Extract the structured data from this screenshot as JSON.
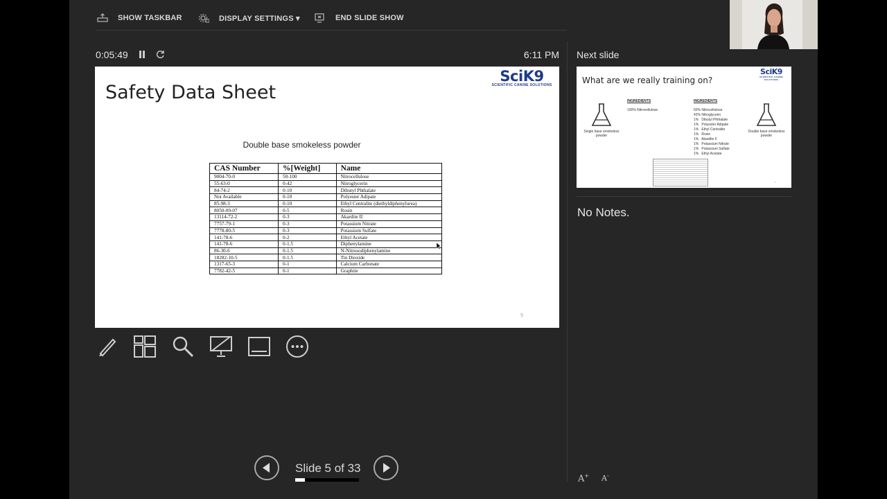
{
  "toolbar": {
    "show_taskbar": "SHOW TASKBAR",
    "display_settings": "DISPLAY SETTINGS ▾",
    "end_slide_show": "END SLIDE SHOW"
  },
  "status": {
    "elapsed": "0:05:49",
    "clock": "6:11 PM"
  },
  "current_slide": {
    "title": "Safety Data Sheet",
    "logo_text": "SciK9",
    "logo_subtext": "SCIENTIFIC CANINE SOLUTIONS",
    "subtitle": "Double base smokeless powder",
    "table": {
      "headers": [
        "CAS Number",
        "%[Weight]",
        "Name"
      ],
      "rows": [
        [
          "9004-70-0",
          "50-100",
          "Nitrocellulose"
        ],
        [
          "55-63-0",
          "0-42",
          "Nitroglycerin"
        ],
        [
          "84-74-2",
          "0-10",
          "Dibutyl Phthalate"
        ],
        [
          "Not Available",
          "0-10",
          "Polyester Adipate"
        ],
        [
          "85-98-3",
          "0-10",
          "Ethyl Centralite (diethyldiphenylurea)"
        ],
        [
          "8050-09-07",
          "0-5",
          "Rosin"
        ],
        [
          "13114-72-2",
          "0-3",
          "Akardite II"
        ],
        [
          "7757-79-1",
          "0-3",
          "Potassium Nitrate"
        ],
        [
          "7778-80-5",
          "0-3",
          "Potassium Sulfate"
        ],
        [
          "141-78-6",
          "0-2",
          "Ethyl Acetate"
        ],
        [
          "141-78-6",
          "0-1.5",
          "Diphenylamine"
        ],
        [
          "86-30-6",
          "0-1.5",
          "N-Nitrosodiphenylamine"
        ],
        [
          "18282-10-5",
          "0-1.5",
          "Tin Dioxide"
        ],
        [
          "1317-65-3",
          "0-1",
          "Calcium Carbonate"
        ],
        [
          "7782-42-5",
          "0-1",
          "Graphite"
        ]
      ]
    },
    "page_number": "5"
  },
  "tools": [
    "pen-icon",
    "slides-grid-icon",
    "zoom-icon",
    "pointer-icon",
    "subtitles-icon",
    "more-icon"
  ],
  "navigation": {
    "slide_counter": "Slide 5 of 33",
    "progress": 0.1515
  },
  "next_slide": {
    "label": "Next slide",
    "title": "What are we really training on?",
    "logo_text": "SciK9",
    "left_caption": "Single base smokeless powder",
    "right_caption": "Double base smokeless powder",
    "ingredients_heading": "INGREDIENTS",
    "left_ingredients": [
      "100% Nitrocellulose"
    ],
    "right_ingredients": [
      "50% Nitrocellulose",
      "42% Nitroglycerin",
      "1%   Dibutyl Phthalate",
      "1%   Polyester Adipate",
      "1%   Ethyl Centralite",
      "1%   Rosin",
      "1%   Akardite II",
      "1%   Potassium Nitrate",
      "1%   Potassium Sulfate",
      "1%   Ethyl Acetate"
    ],
    "page_number": "6"
  },
  "notes": {
    "text": "No Notes."
  },
  "colors": {
    "background": "#262626",
    "brand": "#1f3a8a"
  }
}
